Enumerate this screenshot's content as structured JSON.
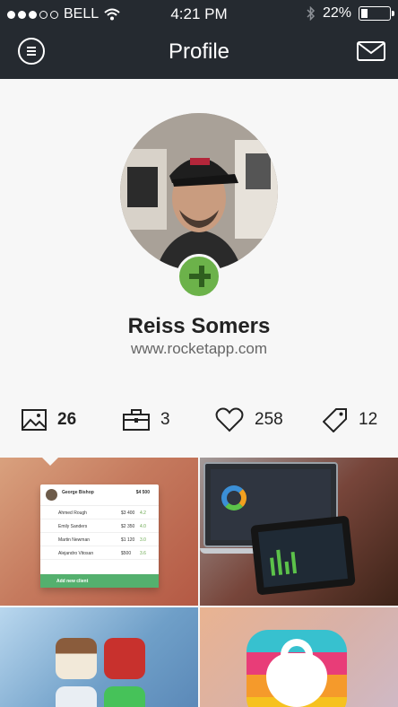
{
  "status": {
    "carrier": "BELL",
    "time": "4:21 PM",
    "battery": "22%",
    "battery_level": 0.22
  },
  "nav": {
    "title": "Profile"
  },
  "profile": {
    "name": "Reiss Somers",
    "website": "www.rocketapp.com"
  },
  "stats": [
    {
      "icon": "image-icon",
      "value": "26"
    },
    {
      "icon": "briefcase-icon",
      "value": "3"
    },
    {
      "icon": "heart-icon",
      "value": "258"
    },
    {
      "icon": "tag-icon",
      "value": "12"
    }
  ],
  "card": {
    "name": "George Bishop",
    "amount": "$4 500",
    "rows": [
      {
        "name": "Ahmed Rough",
        "amount": "$3 400",
        "score": "4.2"
      },
      {
        "name": "Emily Sanders",
        "amount": "$2 350",
        "score": "4.0"
      },
      {
        "name": "Martin Newman",
        "amount": "$1 120",
        "score": "3.0"
      },
      {
        "name": "Alejandro Vitosan",
        "amount": "$500",
        "score": "3.6"
      }
    ],
    "footer": "Add new client"
  },
  "colors": {
    "navbar": "#252a30",
    "accent_green": "#6cb24a"
  }
}
